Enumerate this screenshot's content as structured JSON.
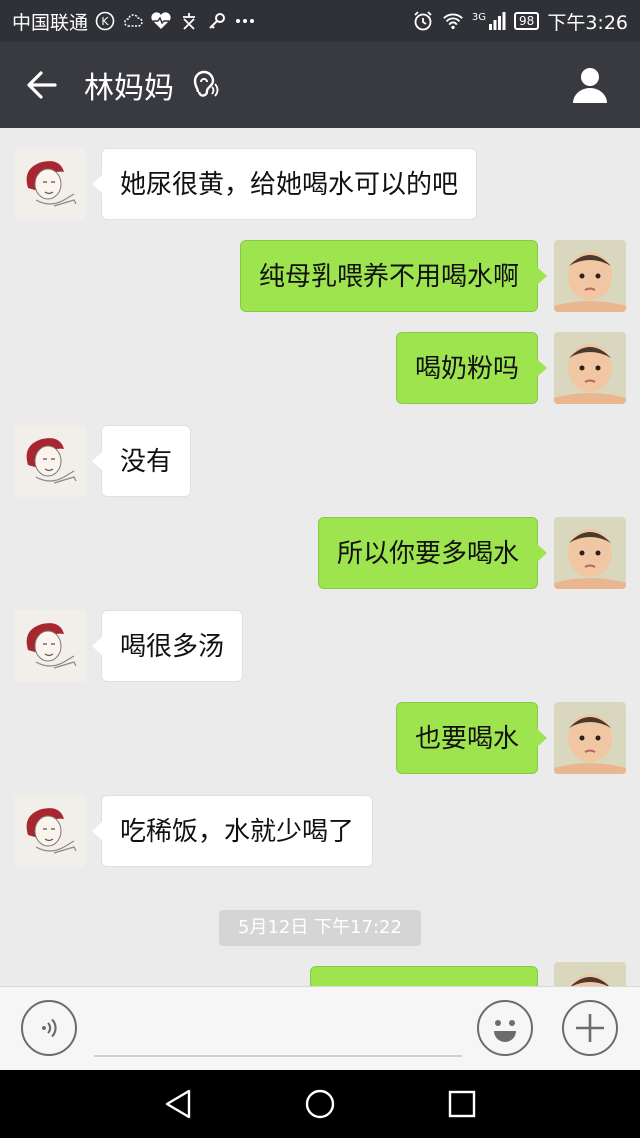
{
  "status_bar": {
    "carrier": "中国联通",
    "network": "3G",
    "battery": "98",
    "time": "下午3:26"
  },
  "header": {
    "title": "林妈妈",
    "back_icon": "arrow-left-icon",
    "profile_icon": "person-icon"
  },
  "messages": [
    {
      "side": "left",
      "text": "她尿很黄，给她喝水可以的吧"
    },
    {
      "side": "right",
      "text": "纯母乳喂养不用喝水啊"
    },
    {
      "side": "right",
      "text": "喝奶粉吗"
    },
    {
      "side": "left",
      "text": "没有"
    },
    {
      "side": "right",
      "text": "所以你要多喝水"
    },
    {
      "side": "left",
      "text": "喝很多汤"
    },
    {
      "side": "right",
      "text": "也要喝水"
    },
    {
      "side": "left",
      "text": "吃稀饭，水就少喝了"
    }
  ],
  "timestamp": "5月12日 下午17:22",
  "input": {
    "value": ""
  },
  "colors": {
    "right_bubble": "#9ee44f",
    "left_bubble": "#ffffff",
    "header_bg": "#393a3f"
  }
}
